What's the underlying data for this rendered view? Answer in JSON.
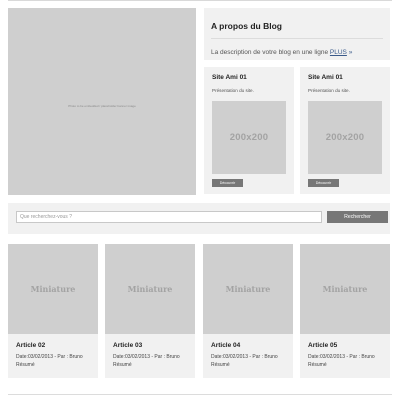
{
  "hero": {
    "caption": "Photo to be embedded / placeholder banner image"
  },
  "about": {
    "title": "A propos du Blog",
    "description": "La description de votre blog en une ligne",
    "more_label": "PLUS",
    "more_arrow": "»"
  },
  "sites": [
    {
      "title": "Site Ami 01",
      "description": "Présentation du site.",
      "thumb_label": "200x200",
      "button_label": "Découvrir"
    },
    {
      "title": "Site Ami 01",
      "description": "Présentation du site.",
      "thumb_label": "200x200",
      "button_label": "Découvrir"
    }
  ],
  "search": {
    "placeholder": "Que recherchez-vous ?",
    "button_label": "Rechercher"
  },
  "articles": [
    {
      "thumb_label": "Miniature",
      "title": "Article 02",
      "meta": "Date:03/02/2013 - Par : Bruno",
      "summary": "Résumé"
    },
    {
      "thumb_label": "Miniature",
      "title": "Article 03",
      "meta": "Date:03/02/2013 - Par : Bruno",
      "summary": "Résumé"
    },
    {
      "thumb_label": "Miniature",
      "title": "Article 04",
      "meta": "Date:03/02/2013 - Par : Bruno",
      "summary": "Résumé"
    },
    {
      "thumb_label": "Miniature",
      "title": "Article 05",
      "meta": "Date:03/02/2013 - Par : Bruno",
      "summary": "Résumé"
    }
  ]
}
